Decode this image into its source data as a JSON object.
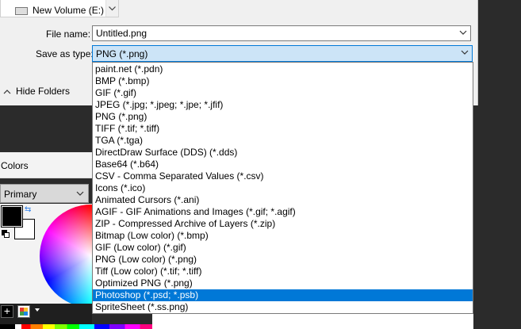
{
  "nav_tree": {
    "partial_item": "New Volume (E:)"
  },
  "form": {
    "file_name_label": "File name:",
    "file_name_value": "Untitled.png",
    "save_as_type_label": "Save as type:",
    "save_as_type_value": "PNG (*.png)"
  },
  "hide_folders_label": "Hide Folders",
  "file_types": [
    "paint.net (*.pdn)",
    "BMP (*.bmp)",
    "GIF (*.gif)",
    "JPEG (*.jpg; *.jpeg; *.jpe; *.jfif)",
    "PNG (*.png)",
    "TIFF (*.tif; *.tiff)",
    "TGA (*.tga)",
    "DirectDraw Surface (DDS) (*.dds)",
    "Base64 (*.b64)",
    "CSV - Comma Separated Values (*.csv)",
    "Icons (*.ico)",
    "Animated Cursors (*.ani)",
    "AGIF - GIF Animations and Images (*.gif; *.agif)",
    "ZIP - Compressed Archive of Layers (*.zip)",
    "Bitmap (Low color) (*.bmp)",
    "GIF (Low color) (*.gif)",
    "PNG (Low color) (*.png)",
    "Tiff (Low color) (*.tif; *.tiff)",
    "Optimized PNG (*.png)",
    "Photoshop (*.psd; *.psb)",
    "SpriteSheet (*.ss.png)"
  ],
  "highlighted_file_type": "Photoshop (*.psd; *.psb)",
  "colors_panel": {
    "title": "Colors",
    "mode_value": "Primary",
    "primary_color": "#000000",
    "secondary_color": "#ffffff"
  },
  "accent_color": "#0078d7"
}
